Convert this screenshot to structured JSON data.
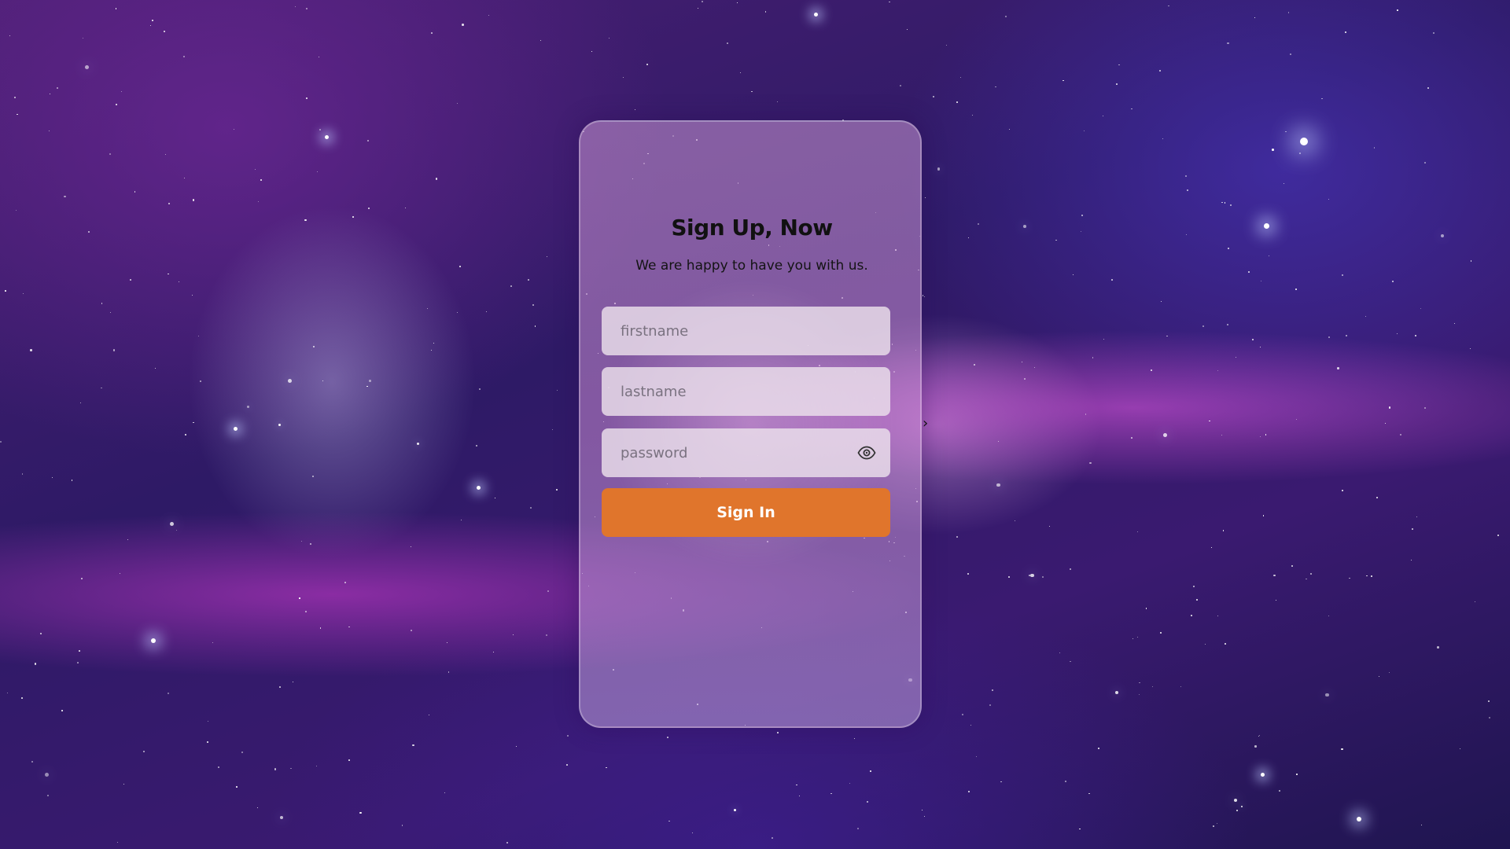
{
  "form": {
    "title": "Sign Up, Now",
    "subtitle": "We are happy to have you with us.",
    "firstname_placeholder": "firstname",
    "lastname_placeholder": "lastname",
    "password_placeholder": "password",
    "submit_label": "Sign In",
    "toggle_password_icon": "eye-icon"
  },
  "side_toggle": {
    "icon": "chevron-right-icon",
    "glyph": "›"
  },
  "colors": {
    "button": "#e0752c",
    "button_text": "#ffffff",
    "title": "#111111"
  }
}
